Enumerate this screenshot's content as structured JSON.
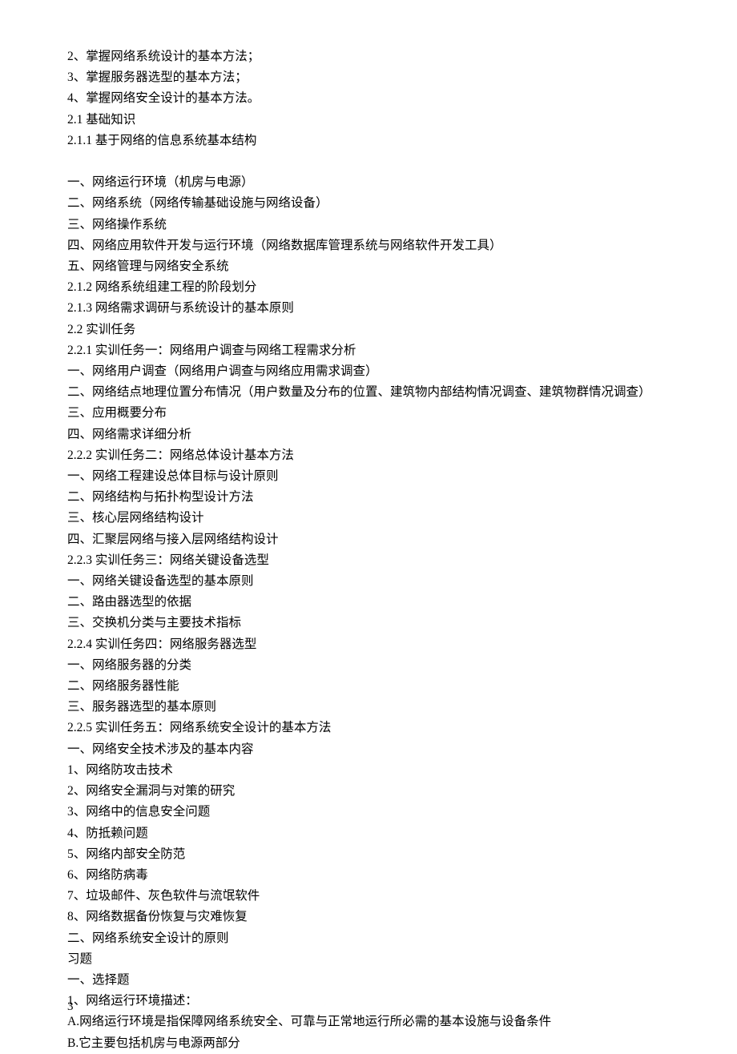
{
  "lines": [
    "2、掌握网络系统设计的基本方法；",
    "3、掌握服务器选型的基本方法；",
    "4、掌握网络安全设计的基本方法。",
    "2.1 基础知识",
    "2.1.1 基于网络的信息系统基本结构",
    "",
    "一、网络运行环境（机房与电源）",
    "二、网络系统（网络传输基础设施与网络设备）",
    "三、网络操作系统",
    "四、网络应用软件开发与运行环境（网络数据库管理系统与网络软件开发工具）",
    "五、网络管理与网络安全系统",
    "2.1.2 网络系统组建工程的阶段划分",
    "2.1.3 网络需求调研与系统设计的基本原则",
    "2.2 实训任务",
    "2.2.1 实训任务一：网络用户调查与网络工程需求分析",
    "一、网络用户调查（网络用户调查与网络应用需求调查）",
    "二、网络结点地理位置分布情况（用户数量及分布的位置、建筑物内部结构情况调查、建筑物群情况调查）",
    "三、应用概要分布",
    "四、网络需求详细分析",
    "2.2.2 实训任务二：网络总体设计基本方法",
    "一、网络工程建设总体目标与设计原则",
    "二、网络结构与拓扑构型设计方法",
    "三、核心层网络结构设计",
    "四、汇聚层网络与接入层网络结构设计",
    "2.2.3 实训任务三：网络关键设备选型",
    "一、网络关键设备选型的基本原则",
    "二、路由器选型的依据",
    "三、交换机分类与主要技术指标",
    "2.2.4 实训任务四：网络服务器选型",
    "一、网络服务器的分类",
    "二、网络服务器性能",
    "三、服务器选型的基本原则",
    "2.2.5 实训任务五：网络系统安全设计的基本方法",
    "一、网络安全技术涉及的基本内容",
    "1、网络防攻击技术",
    "2、网络安全漏洞与对策的研究",
    "3、网络中的信息安全问题",
    "4、防抵赖问题",
    "5、网络内部安全防范",
    "6、网络防病毒",
    "7、垃圾邮件、灰色软件与流氓软件",
    "8、网络数据备份恢复与灾难恢复",
    "二、网络系统安全设计的原则",
    "习题",
    "一、选择题",
    "1、网络运行环境描述：",
    "A.网络运行环境是指保障网络系统安全、可靠与正常地运行所必需的基本设施与设备条件",
    "B.它主要包括机房与电源两部分"
  ],
  "pageNumber": "3"
}
